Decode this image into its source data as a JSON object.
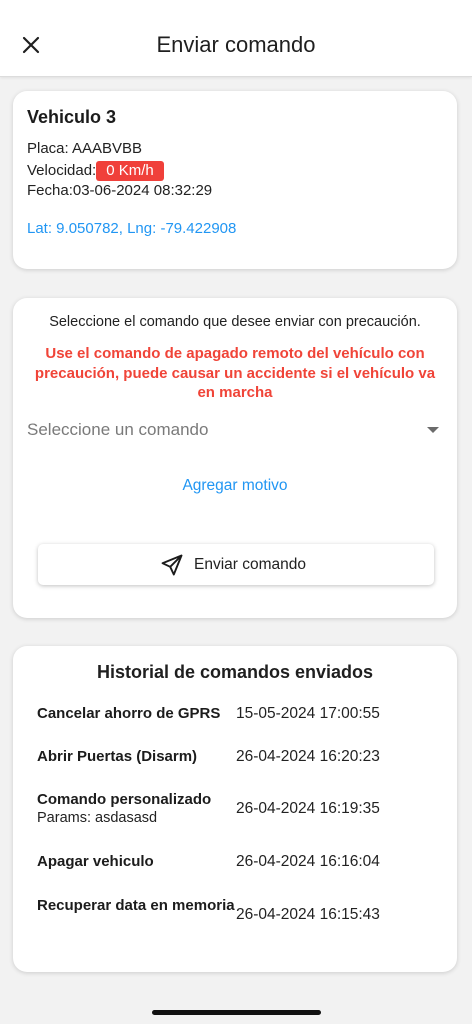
{
  "appbar": {
    "title": "Enviar comando"
  },
  "vehicle": {
    "name": "Vehiculo 3",
    "placa": "Placa: AAABVBB",
    "velocidad_label": "Velocidad:",
    "velocidad_value": "0 Km/h",
    "fecha": "Fecha:03-06-2024 08:32:29",
    "latlng": "Lat: 9.050782, Lng: -79.422908"
  },
  "command": {
    "intro": "Seleccione el comando que desee enviar con precaución.",
    "warning": "Use el comando de apagado remoto del vehículo con precaución, puede causar un accidente si el vehículo va en marcha",
    "select_placeholder": "Seleccione un comando",
    "add_reason": "Agregar motivo",
    "send_label": "Enviar comando"
  },
  "history": {
    "title": "Historial de comandos enviados",
    "rows": [
      {
        "name": "Cancelar ahorro de GPRS",
        "params": "",
        "date": "15-05-2024 17:00:55"
      },
      {
        "name": "Abrir Puertas (Disarm)",
        "params": "",
        "date": "26-04-2024 16:20:23"
      },
      {
        "name": "Comando personalizado",
        "params": "Params: asdasasd",
        "date": "26-04-2024 16:19:35"
      },
      {
        "name": "Apagar vehiculo",
        "params": "",
        "date": "26-04-2024 16:16:04"
      },
      {
        "name": "Recuperar data en memoria",
        "params": "",
        "date": "26-04-2024 16:15:43"
      }
    ]
  },
  "colors": {
    "accent_blue": "#2196f3",
    "warning_red": "#f04438",
    "speed_badge": "#f0403a"
  },
  "icons": {
    "close": "close-icon",
    "send": "send-icon",
    "dropdown": "dropdown-arrow-icon"
  }
}
